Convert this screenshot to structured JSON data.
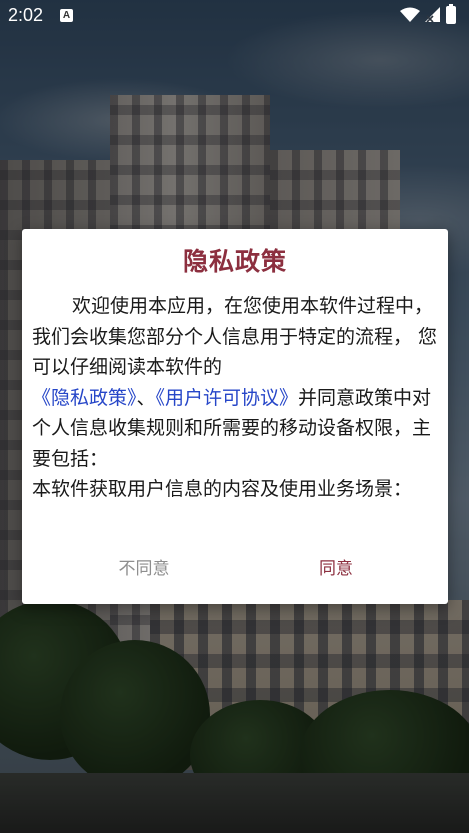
{
  "status_bar": {
    "time": "2:02",
    "notification_badge": "A"
  },
  "dialog": {
    "title": "隐私政策",
    "para1_text": "欢迎使用本应用，在您使用本软件过程中，我们会收集您部分个人信息用于特定的流程， 您可以仔细阅读本软件的",
    "privacy_link": "《隐私政策》",
    "separator": "、",
    "license_link": "《用户许可协议》",
    "para1_tail": "并同意政策中对个人信息收集规则和所需要的移动设备权限，主要包括：",
    "para2_text": "本软件获取用户信息的内容及使用业务场景：",
    "disagree_label": "不同意",
    "agree_label": "同意"
  },
  "colors": {
    "accent": "#8c2f3f",
    "link": "#2646c8",
    "secondary_button": "#8e8e8e"
  },
  "icons": [
    "wifi-icon",
    "signal-icon",
    "battery-icon"
  ]
}
